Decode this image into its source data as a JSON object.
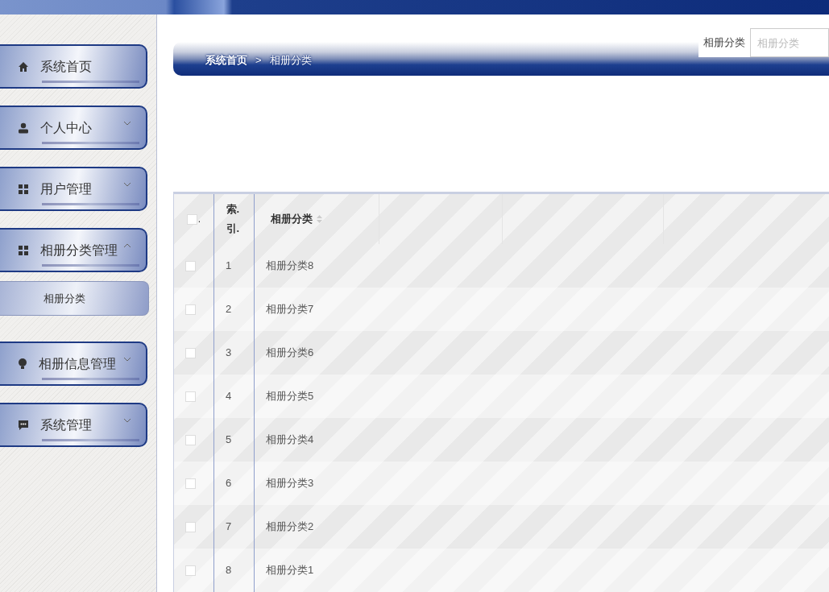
{
  "sidebar": {
    "items": [
      {
        "label": "系统首页"
      },
      {
        "label": "个人中心",
        "expanded": false
      },
      {
        "label": "用户管理",
        "expanded": false
      },
      {
        "label": "相册分类管理",
        "expanded": true,
        "children": [
          {
            "label": "相册分类"
          }
        ]
      },
      {
        "label": "相册信息管理",
        "expanded": false
      },
      {
        "label": "系统管理",
        "expanded": false
      }
    ]
  },
  "breadcrumb": [
    "系统首页",
    ">",
    "相册分类"
  ],
  "search": {
    "label": "相册分类",
    "placeholder": "相册分类"
  },
  "table": {
    "header_checkbox": {
      "checked": false,
      "suffix": "."
    },
    "columns": [
      "索.引.",
      "相册分类"
    ],
    "rows": [
      {
        "checked": false,
        "index": "1",
        "name": "相册分类8"
      },
      {
        "checked": false,
        "index": "2",
        "name": "相册分类7"
      },
      {
        "checked": false,
        "index": "3",
        "name": "相册分类6"
      },
      {
        "checked": false,
        "index": "4",
        "name": "相册分类5"
      },
      {
        "checked": false,
        "index": "5",
        "name": "相册分类4"
      },
      {
        "checked": false,
        "index": "6",
        "name": "相册分类3"
      },
      {
        "checked": false,
        "index": "7",
        "name": "相册分类2"
      },
      {
        "checked": false,
        "index": "8",
        "name": "相册分类1"
      }
    ]
  }
}
